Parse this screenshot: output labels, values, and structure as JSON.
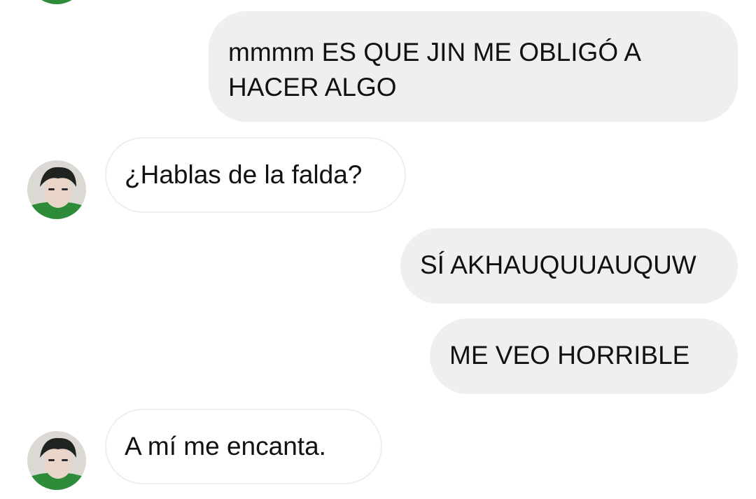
{
  "conversation": {
    "messages": [
      {
        "direction": "outgoing",
        "text": "mmmm ES QUE JIN ME OBLIGÓ A HACER ALGO"
      },
      {
        "direction": "incoming",
        "text": "¿Hablas de la falda?"
      },
      {
        "direction": "outgoing",
        "text": "SÍ AKHAUQUUAUQUW"
      },
      {
        "direction": "outgoing",
        "text": "ME VEO HORRIBLE"
      },
      {
        "direction": "incoming",
        "text": "A mí me encanta."
      }
    ]
  },
  "colors": {
    "outgoing_bubble": "#efefef",
    "incoming_bubble": "#ffffff",
    "incoming_border": "#eeeeee",
    "avatar_accent": "#2e8b3a"
  },
  "icons": {
    "avatar": "user-avatar-icon"
  }
}
